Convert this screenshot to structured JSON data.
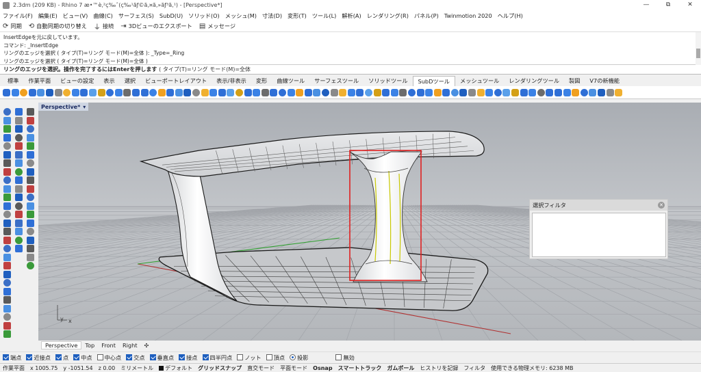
{
  "window": {
    "title": "2.3dm (209 KB) - Rhino 7 æ•™è‚²ç‰ˆ(ç‰¹ãƒ©ã‚¤ã‚»ãƒ³ã‚¹) - [Perspective*]",
    "controls": [
      "—",
      "⧉",
      "✕"
    ]
  },
  "menu": [
    "ファイル(F)",
    "編集(E)",
    "ビュー(V)",
    "曲線(C)",
    "サーフェス(S)",
    "SubD(U)",
    "ソリッド(O)",
    "メッシュ(M)",
    "寸法(D)",
    "変形(T)",
    "ツール(L)",
    "解析(A)",
    "レンダリング(R)",
    "パネル(P)",
    "Twinmotion 2020",
    "ヘルプ(H)"
  ],
  "standard_toolbar": [
    {
      "icon": "sync-icon",
      "label": "同期"
    },
    {
      "icon": "auto-sync-icon",
      "label": "自動同期の切り替え"
    },
    {
      "icon": "plug-icon",
      "label": "接続"
    },
    {
      "icon": "export-3d-icon",
      "label": "3Dビューのエクスポート"
    },
    {
      "icon": "message-icon",
      "label": "メッセージ"
    }
  ],
  "command_history": [
    "InsertEdgeを元に戻しています。",
    "コマンド: _InsertEdge",
    "リングのエッジを選択 ( タイプ(T)=リング  モード(M)=全体 ): _Type=_Ring",
    "リングのエッジを選択 ( タイプ(T)=リング  モード(M)=全体 )"
  ],
  "command_prompt": {
    "prompt": "リングのエッジを選択。操作を完了するにはEnterを押します",
    "options": "( タイプ(T)=リング  モード(M)=全体"
  },
  "toolbar_tabs": [
    "標準",
    "作業平面",
    "ビューの設定",
    "表示",
    "選択",
    "ビューポートレイアウト",
    "表示/非表示",
    "変形",
    "曲線ツール",
    "サーフェスツール",
    "ソリッドツール",
    "SubDツール",
    "メッシュツール",
    "レンダリングツール",
    "製図",
    "V7の新機能"
  ],
  "active_toolbar_tab": "SubDツール",
  "viewport": {
    "name": "Perspective*",
    "dropdown_icon": "chevron-down-icon",
    "axis_x": "x",
    "axis_y": "y",
    "colors": {
      "background": "#b9bcc1",
      "grid_line": "#9b9ea3",
      "selection_box": "#e02020",
      "selected_edge": "#c8c800",
      "x_axis": "#b03030",
      "y_axis": "#30a030"
    }
  },
  "select_filter_panel": {
    "title": "選択フィルタ"
  },
  "viewport_tabs": [
    "Perspective",
    "Top",
    "Front",
    "Right"
  ],
  "viewport_tabs_add_icon": "plus-icon",
  "osnaps": [
    {
      "label": "端点",
      "checked": true
    },
    {
      "label": "近接点",
      "checked": true
    },
    {
      "label": "点",
      "checked": true
    },
    {
      "label": "中点",
      "checked": true
    },
    {
      "label": "中心点",
      "checked": false
    },
    {
      "label": "交点",
      "checked": true
    },
    {
      "label": "垂直点",
      "checked": true
    },
    {
      "label": "接点",
      "checked": true
    },
    {
      "label": "四半円点",
      "checked": true
    },
    {
      "label": "ノット",
      "checked": false
    },
    {
      "label": "頂点",
      "checked": false
    }
  ],
  "osnap_project": {
    "label": "投影",
    "selected": true
  },
  "osnap_disable": {
    "label": "無効",
    "checked": false
  },
  "status_bar": {
    "cplane": "作業平面",
    "x": "x 1005.75",
    "y": "y -1051.54",
    "z": "z 0.00",
    "units": "ミリメートル",
    "layer": "デフォルト",
    "grid_snap": "グリッドスナップ",
    "ortho": "直交モード",
    "planar": "平面モード",
    "osnap": "Osnap",
    "smarttrack": "スマートトラック",
    "gumball": "ガムボール",
    "history": "ヒストリを記録",
    "filter": "フィルタ",
    "memory": "使用できる物理メモリ: 6238 MB"
  }
}
